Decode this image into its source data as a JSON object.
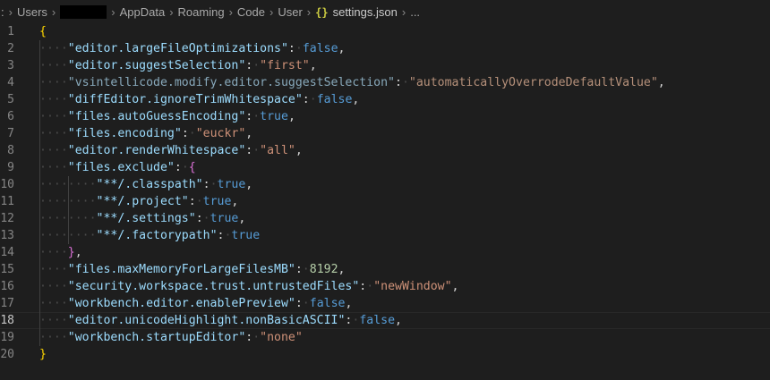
{
  "breadcrumb": {
    "lead": ":",
    "segments": [
      "Users",
      "AppData",
      "Roaming",
      "Code",
      "User"
    ],
    "file": "settings.json",
    "trailing": "...",
    "separator": "›",
    "json_icon_glyph": "{}"
  },
  "editor": {
    "current_line": 18,
    "lines": [
      {
        "n": "1",
        "indent": 0,
        "tokens": [
          {
            "t": "{",
            "c": "brace-1"
          }
        ]
      },
      {
        "n": "2",
        "indent": 1,
        "tokens": [
          {
            "t": "\"editor.largeFileOptimizations\"",
            "c": "key"
          },
          {
            "t": ":",
            "c": "punct"
          },
          {
            "t": "·",
            "c": "ws"
          },
          {
            "t": "false",
            "c": "kw"
          },
          {
            "t": ",",
            "c": "punct"
          }
        ]
      },
      {
        "n": "3",
        "indent": 1,
        "tokens": [
          {
            "t": "\"editor.suggestSelection\"",
            "c": "key"
          },
          {
            "t": ":",
            "c": "punct"
          },
          {
            "t": "·",
            "c": "ws"
          },
          {
            "t": "\"first\"",
            "c": "str"
          },
          {
            "t": ",",
            "c": "punct"
          }
        ]
      },
      {
        "n": "4",
        "indent": 1,
        "tokens": [
          {
            "t": "\"vsintellicode.modify.editor.suggestSelection\"",
            "c": "key-faded"
          },
          {
            "t": ":",
            "c": "punct"
          },
          {
            "t": "·",
            "c": "ws"
          },
          {
            "t": "\"automaticallyOverrodeDefaultValue\"",
            "c": "str-faded"
          },
          {
            "t": ",",
            "c": "punct"
          }
        ]
      },
      {
        "n": "5",
        "indent": 1,
        "tokens": [
          {
            "t": "\"diffEditor.ignoreTrimWhitespace\"",
            "c": "key"
          },
          {
            "t": ":",
            "c": "punct"
          },
          {
            "t": "·",
            "c": "ws"
          },
          {
            "t": "false",
            "c": "kw"
          },
          {
            "t": ",",
            "c": "punct"
          }
        ]
      },
      {
        "n": "6",
        "indent": 1,
        "tokens": [
          {
            "t": "\"files.autoGuessEncoding\"",
            "c": "key"
          },
          {
            "t": ":",
            "c": "punct"
          },
          {
            "t": "·",
            "c": "ws"
          },
          {
            "t": "true",
            "c": "kw"
          },
          {
            "t": ",",
            "c": "punct"
          }
        ]
      },
      {
        "n": "7",
        "indent": 1,
        "tokens": [
          {
            "t": "\"files.encoding\"",
            "c": "key"
          },
          {
            "t": ":",
            "c": "punct"
          },
          {
            "t": "·",
            "c": "ws"
          },
          {
            "t": "\"euckr\"",
            "c": "str"
          },
          {
            "t": ",",
            "c": "punct"
          }
        ]
      },
      {
        "n": "8",
        "indent": 1,
        "tokens": [
          {
            "t": "\"editor.renderWhitespace\"",
            "c": "key"
          },
          {
            "t": ":",
            "c": "punct"
          },
          {
            "t": "·",
            "c": "ws"
          },
          {
            "t": "\"all\"",
            "c": "str"
          },
          {
            "t": ",",
            "c": "punct"
          }
        ]
      },
      {
        "n": "9",
        "indent": 1,
        "tokens": [
          {
            "t": "\"files.exclude\"",
            "c": "key"
          },
          {
            "t": ":",
            "c": "punct"
          },
          {
            "t": "·",
            "c": "ws"
          },
          {
            "t": "{",
            "c": "brace-2"
          }
        ]
      },
      {
        "n": "10",
        "indent": 2,
        "tokens": [
          {
            "t": "\"**/.classpath\"",
            "c": "key"
          },
          {
            "t": ":",
            "c": "punct"
          },
          {
            "t": "·",
            "c": "ws"
          },
          {
            "t": "true",
            "c": "kw"
          },
          {
            "t": ",",
            "c": "punct"
          }
        ]
      },
      {
        "n": "11",
        "indent": 2,
        "tokens": [
          {
            "t": "\"**/.project\"",
            "c": "key"
          },
          {
            "t": ":",
            "c": "punct"
          },
          {
            "t": "·",
            "c": "ws"
          },
          {
            "t": "true",
            "c": "kw"
          },
          {
            "t": ",",
            "c": "punct"
          }
        ]
      },
      {
        "n": "12",
        "indent": 2,
        "tokens": [
          {
            "t": "\"**/.settings\"",
            "c": "key"
          },
          {
            "t": ":",
            "c": "punct"
          },
          {
            "t": "·",
            "c": "ws"
          },
          {
            "t": "true",
            "c": "kw"
          },
          {
            "t": ",",
            "c": "punct"
          }
        ]
      },
      {
        "n": "13",
        "indent": 2,
        "tokens": [
          {
            "t": "\"**/.factorypath\"",
            "c": "key"
          },
          {
            "t": ":",
            "c": "punct"
          },
          {
            "t": "·",
            "c": "ws"
          },
          {
            "t": "true",
            "c": "kw"
          }
        ]
      },
      {
        "n": "14",
        "indent": 1,
        "tokens": [
          {
            "t": "}",
            "c": "brace-2"
          },
          {
            "t": ",",
            "c": "punct"
          }
        ]
      },
      {
        "n": "15",
        "indent": 1,
        "tokens": [
          {
            "t": "\"files.maxMemoryForLargeFilesMB\"",
            "c": "key"
          },
          {
            "t": ":",
            "c": "punct"
          },
          {
            "t": "·",
            "c": "ws"
          },
          {
            "t": "8192",
            "c": "num"
          },
          {
            "t": ",",
            "c": "punct"
          }
        ]
      },
      {
        "n": "16",
        "indent": 1,
        "tokens": [
          {
            "t": "\"security.workspace.trust.untrustedFiles\"",
            "c": "key"
          },
          {
            "t": ":",
            "c": "punct"
          },
          {
            "t": "·",
            "c": "ws"
          },
          {
            "t": "\"newWindow\"",
            "c": "str"
          },
          {
            "t": ",",
            "c": "punct"
          }
        ]
      },
      {
        "n": "17",
        "indent": 1,
        "tokens": [
          {
            "t": "\"workbench.editor.enablePreview\"",
            "c": "key"
          },
          {
            "t": ":",
            "c": "punct"
          },
          {
            "t": "·",
            "c": "ws"
          },
          {
            "t": "false",
            "c": "kw"
          },
          {
            "t": ",",
            "c": "punct"
          }
        ]
      },
      {
        "n": "18",
        "indent": 1,
        "tokens": [
          {
            "t": "\"editor.unicodeHighlight.nonBasicASCII\"",
            "c": "key"
          },
          {
            "t": ":",
            "c": "punct"
          },
          {
            "t": "·",
            "c": "ws"
          },
          {
            "t": "false",
            "c": "kw"
          },
          {
            "t": ",",
            "c": "punct"
          }
        ]
      },
      {
        "n": "19",
        "indent": 1,
        "tokens": [
          {
            "t": "\"workbench.startupEditor\"",
            "c": "key"
          },
          {
            "t": ":",
            "c": "punct"
          },
          {
            "t": "·",
            "c": "ws"
          },
          {
            "t": "\"none\"",
            "c": "str"
          }
        ]
      },
      {
        "n": "20",
        "indent": 0,
        "tokens": [
          {
            "t": "}",
            "c": "brace-1"
          }
        ]
      }
    ]
  },
  "colors": {
    "background": "#1e1e1e",
    "key": "#9cdcfe",
    "string": "#ce9178",
    "keyword": "#569cd6",
    "number": "#b5cea8",
    "brace_level_1": "#ffd700",
    "brace_level_2": "#da70d6",
    "line_number": "#858585",
    "json_icon": "#cbcb41"
  }
}
